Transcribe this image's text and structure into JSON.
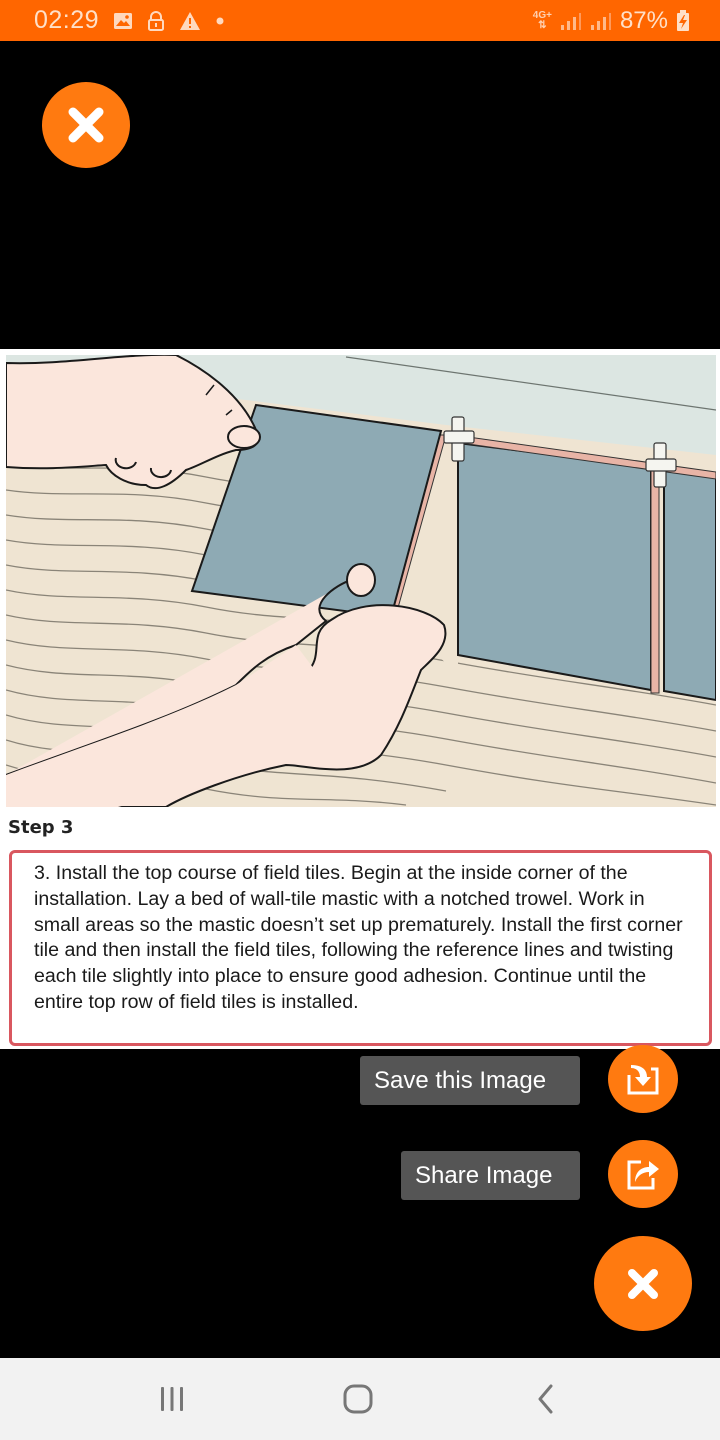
{
  "status_bar": {
    "time": "02:29",
    "notification_icons": [
      "gallery-icon",
      "lock-icon",
      "warning-icon",
      "dot-icon"
    ],
    "network_type": "4G+",
    "battery_percent": "87%",
    "battery_state": "charging"
  },
  "viewer": {
    "step_heading": "Step 3",
    "step_text": "3. Install the top course of field tiles. Begin at the inside corner of the installation. Lay a bed of wall-tile mastic with a notched trowel. Work in small areas so the mastic doesn’t set up prematurely. Install the first corner tile and then install the field tiles, following the reference lines and twisting each tile slightly into place to ensure good adhesion. Continue until the entire top row of field tiles is installed.",
    "illustration_description": "Hands pressing a blue-gray wall tile into notched mastic beside tiles separated by plastic spacers"
  },
  "actions": {
    "save_label": "Save this Image",
    "share_label": "Share Image"
  },
  "colors": {
    "accent": "#ff7a10",
    "status_bar": "#ff6600",
    "step_box_border": "#d9575f",
    "label_bg": "#555555",
    "nav_bar": "#f2f2f2"
  },
  "nav_bar": {
    "buttons": [
      "recent-apps",
      "home",
      "back"
    ]
  }
}
